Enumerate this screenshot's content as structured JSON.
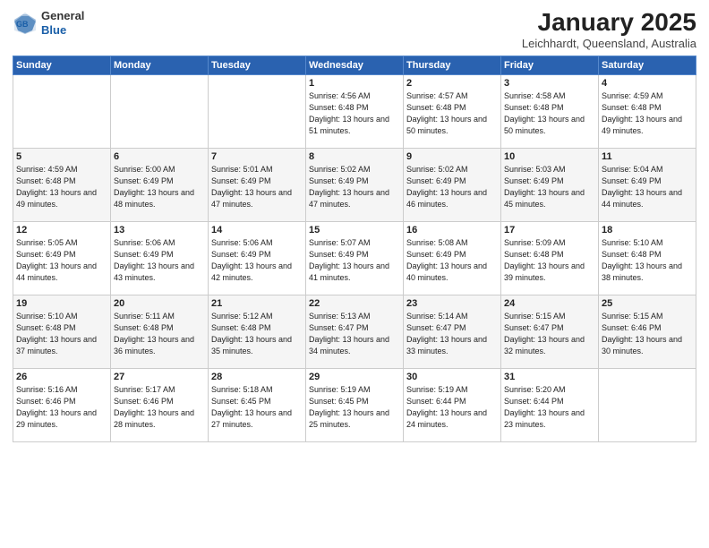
{
  "header": {
    "logo_general": "General",
    "logo_blue": "Blue",
    "month_title": "January 2025",
    "location": "Leichhardt, Queensland, Australia"
  },
  "weekdays": [
    "Sunday",
    "Monday",
    "Tuesday",
    "Wednesday",
    "Thursday",
    "Friday",
    "Saturday"
  ],
  "weeks": [
    [
      {
        "day": "",
        "sunrise": "",
        "sunset": "",
        "daylight": ""
      },
      {
        "day": "",
        "sunrise": "",
        "sunset": "",
        "daylight": ""
      },
      {
        "day": "",
        "sunrise": "",
        "sunset": "",
        "daylight": ""
      },
      {
        "day": "1",
        "sunrise": "Sunrise: 4:56 AM",
        "sunset": "Sunset: 6:48 PM",
        "daylight": "Daylight: 13 hours and 51 minutes."
      },
      {
        "day": "2",
        "sunrise": "Sunrise: 4:57 AM",
        "sunset": "Sunset: 6:48 PM",
        "daylight": "Daylight: 13 hours and 50 minutes."
      },
      {
        "day": "3",
        "sunrise": "Sunrise: 4:58 AM",
        "sunset": "Sunset: 6:48 PM",
        "daylight": "Daylight: 13 hours and 50 minutes."
      },
      {
        "day": "4",
        "sunrise": "Sunrise: 4:59 AM",
        "sunset": "Sunset: 6:48 PM",
        "daylight": "Daylight: 13 hours and 49 minutes."
      }
    ],
    [
      {
        "day": "5",
        "sunrise": "Sunrise: 4:59 AM",
        "sunset": "Sunset: 6:48 PM",
        "daylight": "Daylight: 13 hours and 49 minutes."
      },
      {
        "day": "6",
        "sunrise": "Sunrise: 5:00 AM",
        "sunset": "Sunset: 6:49 PM",
        "daylight": "Daylight: 13 hours and 48 minutes."
      },
      {
        "day": "7",
        "sunrise": "Sunrise: 5:01 AM",
        "sunset": "Sunset: 6:49 PM",
        "daylight": "Daylight: 13 hours and 47 minutes."
      },
      {
        "day": "8",
        "sunrise": "Sunrise: 5:02 AM",
        "sunset": "Sunset: 6:49 PM",
        "daylight": "Daylight: 13 hours and 47 minutes."
      },
      {
        "day": "9",
        "sunrise": "Sunrise: 5:02 AM",
        "sunset": "Sunset: 6:49 PM",
        "daylight": "Daylight: 13 hours and 46 minutes."
      },
      {
        "day": "10",
        "sunrise": "Sunrise: 5:03 AM",
        "sunset": "Sunset: 6:49 PM",
        "daylight": "Daylight: 13 hours and 45 minutes."
      },
      {
        "day": "11",
        "sunrise": "Sunrise: 5:04 AM",
        "sunset": "Sunset: 6:49 PM",
        "daylight": "Daylight: 13 hours and 44 minutes."
      }
    ],
    [
      {
        "day": "12",
        "sunrise": "Sunrise: 5:05 AM",
        "sunset": "Sunset: 6:49 PM",
        "daylight": "Daylight: 13 hours and 44 minutes."
      },
      {
        "day": "13",
        "sunrise": "Sunrise: 5:06 AM",
        "sunset": "Sunset: 6:49 PM",
        "daylight": "Daylight: 13 hours and 43 minutes."
      },
      {
        "day": "14",
        "sunrise": "Sunrise: 5:06 AM",
        "sunset": "Sunset: 6:49 PM",
        "daylight": "Daylight: 13 hours and 42 minutes."
      },
      {
        "day": "15",
        "sunrise": "Sunrise: 5:07 AM",
        "sunset": "Sunset: 6:49 PM",
        "daylight": "Daylight: 13 hours and 41 minutes."
      },
      {
        "day": "16",
        "sunrise": "Sunrise: 5:08 AM",
        "sunset": "Sunset: 6:49 PM",
        "daylight": "Daylight: 13 hours and 40 minutes."
      },
      {
        "day": "17",
        "sunrise": "Sunrise: 5:09 AM",
        "sunset": "Sunset: 6:48 PM",
        "daylight": "Daylight: 13 hours and 39 minutes."
      },
      {
        "day": "18",
        "sunrise": "Sunrise: 5:10 AM",
        "sunset": "Sunset: 6:48 PM",
        "daylight": "Daylight: 13 hours and 38 minutes."
      }
    ],
    [
      {
        "day": "19",
        "sunrise": "Sunrise: 5:10 AM",
        "sunset": "Sunset: 6:48 PM",
        "daylight": "Daylight: 13 hours and 37 minutes."
      },
      {
        "day": "20",
        "sunrise": "Sunrise: 5:11 AM",
        "sunset": "Sunset: 6:48 PM",
        "daylight": "Daylight: 13 hours and 36 minutes."
      },
      {
        "day": "21",
        "sunrise": "Sunrise: 5:12 AM",
        "sunset": "Sunset: 6:48 PM",
        "daylight": "Daylight: 13 hours and 35 minutes."
      },
      {
        "day": "22",
        "sunrise": "Sunrise: 5:13 AM",
        "sunset": "Sunset: 6:47 PM",
        "daylight": "Daylight: 13 hours and 34 minutes."
      },
      {
        "day": "23",
        "sunrise": "Sunrise: 5:14 AM",
        "sunset": "Sunset: 6:47 PM",
        "daylight": "Daylight: 13 hours and 33 minutes."
      },
      {
        "day": "24",
        "sunrise": "Sunrise: 5:15 AM",
        "sunset": "Sunset: 6:47 PM",
        "daylight": "Daylight: 13 hours and 32 minutes."
      },
      {
        "day": "25",
        "sunrise": "Sunrise: 5:15 AM",
        "sunset": "Sunset: 6:46 PM",
        "daylight": "Daylight: 13 hours and 30 minutes."
      }
    ],
    [
      {
        "day": "26",
        "sunrise": "Sunrise: 5:16 AM",
        "sunset": "Sunset: 6:46 PM",
        "daylight": "Daylight: 13 hours and 29 minutes."
      },
      {
        "day": "27",
        "sunrise": "Sunrise: 5:17 AM",
        "sunset": "Sunset: 6:46 PM",
        "daylight": "Daylight: 13 hours and 28 minutes."
      },
      {
        "day": "28",
        "sunrise": "Sunrise: 5:18 AM",
        "sunset": "Sunset: 6:45 PM",
        "daylight": "Daylight: 13 hours and 27 minutes."
      },
      {
        "day": "29",
        "sunrise": "Sunrise: 5:19 AM",
        "sunset": "Sunset: 6:45 PM",
        "daylight": "Daylight: 13 hours and 25 minutes."
      },
      {
        "day": "30",
        "sunrise": "Sunrise: 5:19 AM",
        "sunset": "Sunset: 6:44 PM",
        "daylight": "Daylight: 13 hours and 24 minutes."
      },
      {
        "day": "31",
        "sunrise": "Sunrise: 5:20 AM",
        "sunset": "Sunset: 6:44 PM",
        "daylight": "Daylight: 13 hours and 23 minutes."
      },
      {
        "day": "",
        "sunrise": "",
        "sunset": "",
        "daylight": ""
      }
    ]
  ]
}
